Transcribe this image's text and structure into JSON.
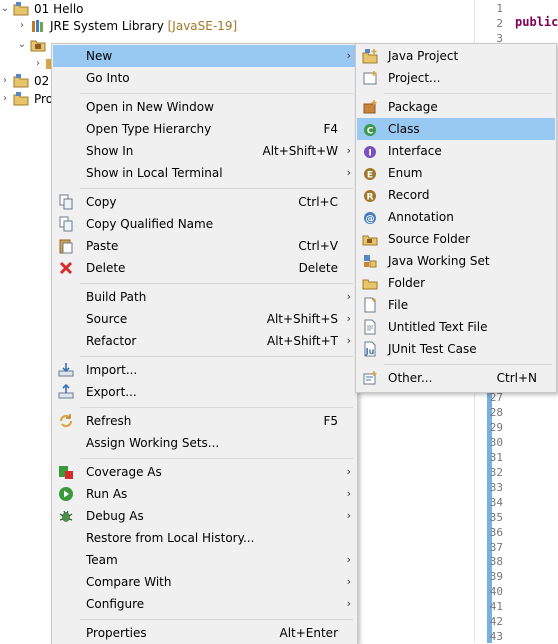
{
  "tree": {
    "project1": "01 Hello",
    "jre_label": "JRE System Library",
    "jre_version": "[JavaSE-19]",
    "project2": "02",
    "project3": "Pro"
  },
  "editor": {
    "keyword": "public",
    "lines_top": [
      "1",
      "2",
      "3"
    ],
    "lines_bottom": [
      "27",
      "28",
      "29",
      "30",
      "31",
      "32",
      "33",
      "34",
      "35",
      "36",
      "37",
      "38",
      "39",
      "40",
      "41",
      "42",
      "43"
    ]
  },
  "context_menu": {
    "new": "New",
    "go_into": "Go Into",
    "open_new_window": "Open in New Window",
    "open_type_hierarchy": "Open Type Hierarchy",
    "open_type_hierarchy_sc": "F4",
    "show_in": "Show In",
    "show_in_sc": "Alt+Shift+W",
    "show_in_local_terminal": "Show in Local Terminal",
    "copy": "Copy",
    "copy_sc": "Ctrl+C",
    "copy_qualified_name": "Copy Qualified Name",
    "paste": "Paste",
    "paste_sc": "Ctrl+V",
    "delete": "Delete",
    "delete_sc": "Delete",
    "build_path": "Build Path",
    "source": "Source",
    "source_sc": "Alt+Shift+S",
    "refactor": "Refactor",
    "refactor_sc": "Alt+Shift+T",
    "import": "Import...",
    "export": "Export...",
    "refresh": "Refresh",
    "refresh_sc": "F5",
    "assign_working_sets": "Assign Working Sets...",
    "coverage_as": "Coverage As",
    "run_as": "Run As",
    "debug_as": "Debug As",
    "restore_local_history": "Restore from Local History...",
    "team": "Team",
    "compare_with": "Compare With",
    "configure": "Configure",
    "properties": "Properties",
    "properties_sc": "Alt+Enter",
    "submenu_arrow": "›"
  },
  "new_submenu": {
    "java_project": "Java Project",
    "project": "Project...",
    "package": "Package",
    "class": "Class",
    "interface": "Interface",
    "enum": "Enum",
    "record": "Record",
    "annotation": "Annotation",
    "source_folder": "Source Folder",
    "java_working_set": "Java Working Set",
    "folder": "Folder",
    "file": "File",
    "untitled_text_file": "Untitled Text File",
    "junit_test_case": "JUnit Test Case",
    "other": "Other...",
    "other_sc": "Ctrl+N"
  },
  "colors": {
    "menu_bg": "#f0f0f0",
    "highlight": "#98c9f2",
    "keyword": "#7f0055"
  }
}
